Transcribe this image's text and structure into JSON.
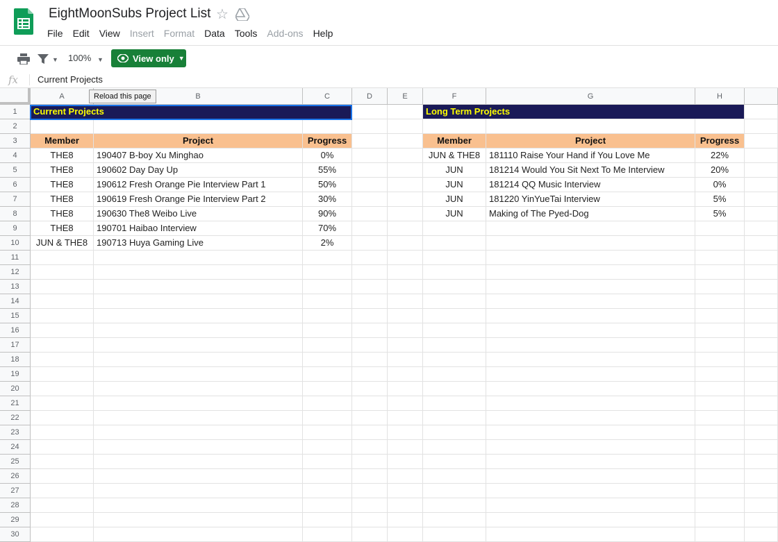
{
  "doc": {
    "title": "EightMoonSubs Project List"
  },
  "icons": {
    "app": "sheets-logo-icon",
    "star": "star-icon",
    "drive": "drive-icon",
    "print": "print-icon",
    "filter": "filter-icon",
    "eye": "eye-icon"
  },
  "menu": [
    {
      "label": "File",
      "enabled": true
    },
    {
      "label": "Edit",
      "enabled": true
    },
    {
      "label": "View",
      "enabled": true
    },
    {
      "label": "Insert",
      "enabled": false
    },
    {
      "label": "Format",
      "enabled": false
    },
    {
      "label": "Data",
      "enabled": true
    },
    {
      "label": "Tools",
      "enabled": true
    },
    {
      "label": "Add-ons",
      "enabled": false
    },
    {
      "label": "Help",
      "enabled": true
    }
  ],
  "toolbar": {
    "zoom": "100%",
    "view_only": "View only"
  },
  "formula_bar": {
    "fx": "fx",
    "value": "Current Projects"
  },
  "tooltip": "Reload this page",
  "columns": [
    "A",
    "B",
    "C",
    "D",
    "E",
    "F",
    "G",
    "H"
  ],
  "rows": [
    "1",
    "2",
    "3",
    "4",
    "5",
    "6",
    "7",
    "8",
    "9",
    "10",
    "11",
    "12",
    "13",
    "14",
    "15",
    "16",
    "17",
    "18",
    "19",
    "20",
    "21",
    "22",
    "23",
    "24",
    "25",
    "26",
    "27",
    "28",
    "29",
    "30"
  ],
  "current": {
    "title": "Current Projects",
    "headers": [
      "Member",
      "Project",
      "Progress"
    ],
    "items": [
      {
        "member": "THE8",
        "project": "190407 B-boy Xu Minghao",
        "progress": "0%"
      },
      {
        "member": "THE8",
        "project": "190602 Day Day Up",
        "progress": "55%"
      },
      {
        "member": "THE8",
        "project": "190612 Fresh Orange Pie Interview Part 1",
        "progress": "50%"
      },
      {
        "member": "THE8",
        "project": "190619 Fresh Orange Pie Interview Part 2",
        "progress": "30%"
      },
      {
        "member": "THE8",
        "project": "190630 The8 Weibo Live",
        "progress": "90%"
      },
      {
        "member": "THE8",
        "project": "190701 Haibao Interview",
        "progress": "70%"
      },
      {
        "member": "JUN & THE8",
        "project": "190713 Huya Gaming Live",
        "progress": "2%"
      }
    ]
  },
  "longterm": {
    "title": "Long Term Projects",
    "headers": [
      "Member",
      "Project",
      "Progress"
    ],
    "items": [
      {
        "member": "JUN & THE8",
        "project": "181110 Raise Your Hand if You Love Me",
        "progress": "22%"
      },
      {
        "member": "JUN",
        "project": "181214 Would You Sit Next To Me Interview",
        "progress": "20%"
      },
      {
        "member": "JUN",
        "project": "181214 QQ Music Interview",
        "progress": "0%"
      },
      {
        "member": "JUN",
        "project": "181220 YinYueTai Interview",
        "progress": "5%"
      },
      {
        "member": "JUN",
        "project": "Making of The Pyed-Dog",
        "progress": "5%"
      }
    ]
  },
  "colors": {
    "title_bg": "#1a1a57",
    "title_fg": "#ffff00",
    "header_bg": "#f9c08f",
    "view_btn": "#188038"
  }
}
